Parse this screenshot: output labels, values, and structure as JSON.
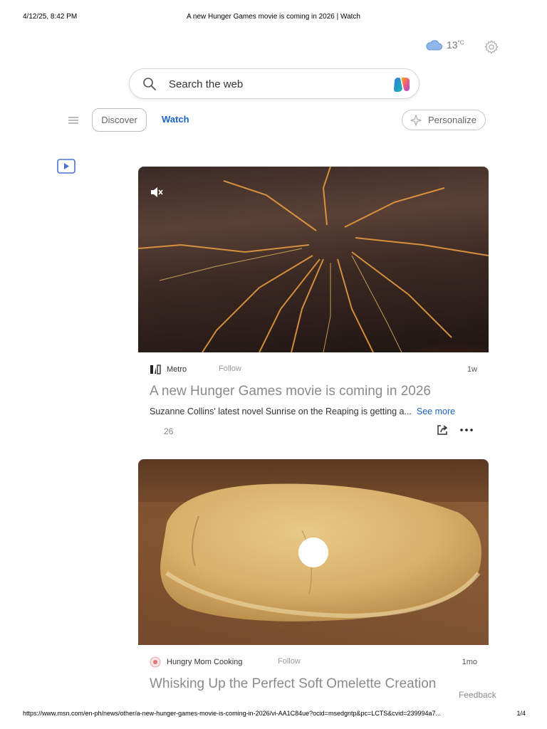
{
  "print": {
    "date": "4/12/25, 8:42 PM",
    "title": "A new Hunger Games movie is coming in 2026 | Watch",
    "url": "https://www.msn.com/en-ph/news/other/a-new-hunger-games-movie-is-coming-in-2026/vi-AA1C84ue?ocid=msedgntp&pc=LCTS&cvid=239994a7...",
    "page": "1/4"
  },
  "weather": {
    "temp": "13",
    "unit": "°C",
    "icon": "cloud-icon"
  },
  "search": {
    "placeholder": "Search the web"
  },
  "nav": {
    "tabs": [
      {
        "label": "Discover"
      },
      {
        "label": "Watch"
      }
    ],
    "personalize_label": "Personalize"
  },
  "cards": [
    {
      "source": "Metro",
      "follow": "Follow",
      "age": "1w",
      "title": "A new Hunger Games movie is coming in 2026",
      "description": "Suzanne Collins' latest novel Sunrise on the Reaping is getting a...",
      "see_more": "See more",
      "likes": "26"
    },
    {
      "source": "Hungry Mom Cooking",
      "follow": "Follow",
      "age": "1mo",
      "title": "Whisking Up the Perfect Soft Omelette Creation"
    }
  ],
  "feedback": "Feedback",
  "colors": {
    "accent": "#1a64c8"
  }
}
